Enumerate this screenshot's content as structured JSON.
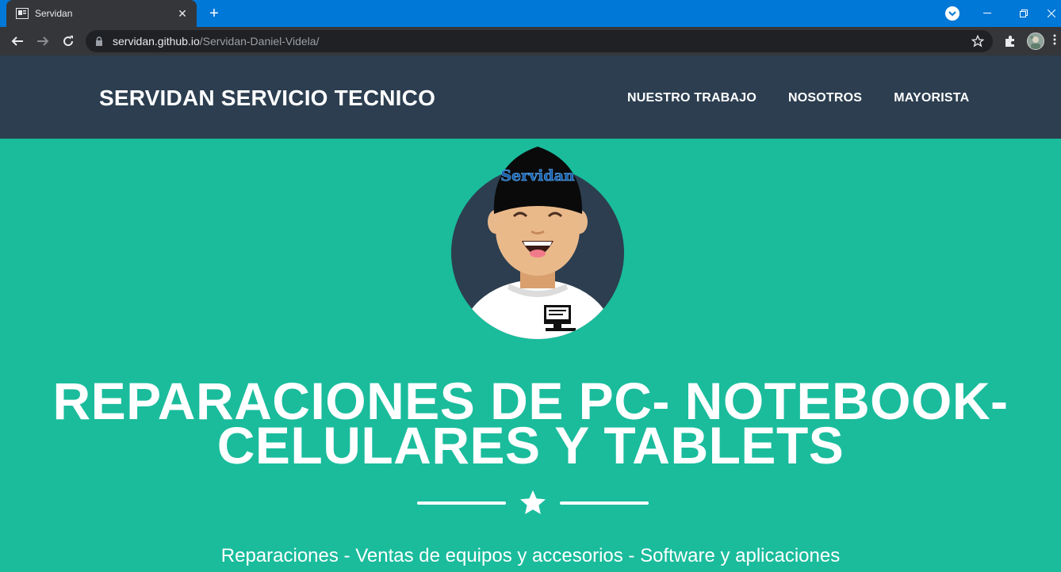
{
  "browser": {
    "tab_title": "Servidan",
    "tab_close": "✕",
    "new_tab": "+",
    "url_host": "servidan.github.io",
    "url_path": "/Servidan-Daniel-Videla/"
  },
  "site": {
    "brand": "SERVIDAN SERVICIO TECNICO",
    "nav": [
      "NUESTRO TRABAJO",
      "NOSOTROS",
      "MAYORISTA"
    ],
    "avatar_cap_text": "Servidan",
    "headline_line1": "REPARACIONES DE PC- NOTEBOOK-",
    "headline_line2": "CELULARES Y TABLETS",
    "subtitle": "Reparaciones - Ventas de equipos y accesorios - Software y aplicaciones"
  },
  "colors": {
    "hero_bg": "#1abc9c",
    "nav_bg": "#2c3e50",
    "browser_titlebar": "#0078d7"
  }
}
